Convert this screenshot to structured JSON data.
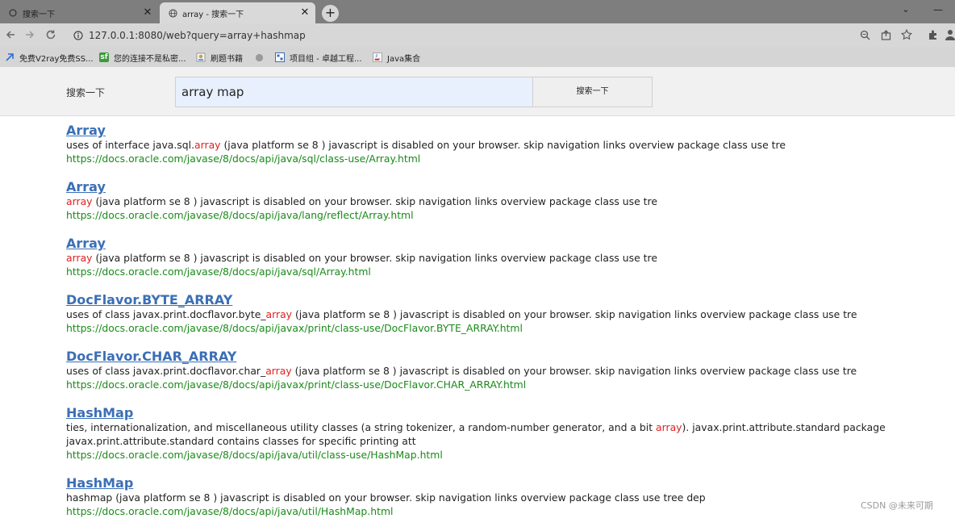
{
  "browser": {
    "tabs": [
      {
        "title": "搜索一下",
        "active": false
      },
      {
        "title": "array - 搜索一下",
        "active": true
      }
    ],
    "address": "127.0.0.1:8080/web?query=array+hashmap",
    "bookmarks": [
      {
        "label": "免费V2ray免费SS...",
        "icon": "bookmark-icon"
      },
      {
        "label": "您的连接不是私密...",
        "icon": "sf-icon"
      },
      {
        "label": "刷题书籍",
        "icon": "book-icon"
      },
      {
        "label": "项目组 - 卓越工程...",
        "icon": "project-icon"
      },
      {
        "label": "Java集合",
        "icon": "java-icon"
      }
    ]
  },
  "page": {
    "brand": "搜索一下",
    "search_value": "array map",
    "search_button": "搜索一下"
  },
  "results": [
    {
      "title": "Array",
      "snippet": [
        [
          {
            "t": "uses of interface java.sql.",
            "h": false
          },
          {
            "t": "array",
            "h": true
          },
          {
            "t": " (java platform se 8 ) javascript is disabled on your browser. skip navigation links overview package class use tre",
            "h": false
          }
        ]
      ],
      "url": "https://docs.oracle.com/javase/8/docs/api/java/sql/class-use/Array.html"
    },
    {
      "title": "Array",
      "snippet": [
        [
          {
            "t": "array",
            "h": true
          },
          {
            "t": " (java platform se 8 ) javascript is disabled on your browser. skip navigation links overview package class use tre",
            "h": false
          }
        ]
      ],
      "url": "https://docs.oracle.com/javase/8/docs/api/java/lang/reflect/Array.html"
    },
    {
      "title": "Array",
      "snippet": [
        [
          {
            "t": "array",
            "h": true
          },
          {
            "t": " (java platform se 8 ) javascript is disabled on your browser. skip navigation links overview package class use tre",
            "h": false
          }
        ]
      ],
      "url": "https://docs.oracle.com/javase/8/docs/api/java/sql/Array.html"
    },
    {
      "title": "DocFlavor.BYTE_ARRAY",
      "snippet": [
        [
          {
            "t": "uses of class javax.print.docflavor.byte_",
            "h": false
          },
          {
            "t": "array",
            "h": true
          },
          {
            "t": " (java platform se 8 ) javascript is disabled on your browser. skip navigation links overview package class use tre",
            "h": false
          }
        ]
      ],
      "url": "https://docs.oracle.com/javase/8/docs/api/javax/print/class-use/DocFlavor.BYTE_ARRAY.html"
    },
    {
      "title": "DocFlavor.CHAR_ARRAY",
      "snippet": [
        [
          {
            "t": "uses of class javax.print.docflavor.char_",
            "h": false
          },
          {
            "t": "array",
            "h": true
          },
          {
            "t": " (java platform se 8 ) javascript is disabled on your browser. skip navigation links overview package class use tre",
            "h": false
          }
        ]
      ],
      "url": "https://docs.oracle.com/javase/8/docs/api/javax/print/class-use/DocFlavor.CHAR_ARRAY.html"
    },
    {
      "title": "HashMap",
      "snippet": [
        [
          {
            "t": "ties, internationalization, and miscellaneous utility classes (a string tokenizer, a random-number generator, and a bit ",
            "h": false
          },
          {
            "t": "array",
            "h": true
          },
          {
            "t": "). javax.print.attribute.standard package",
            "h": false
          }
        ],
        [
          {
            "t": "javax.print.attribute.standard contains classes for specific printing att",
            "h": false
          }
        ]
      ],
      "url": "https://docs.oracle.com/javase/8/docs/api/java/util/class-use/HashMap.html"
    },
    {
      "title": "HashMap",
      "snippet": [
        [
          {
            "t": "hashmap (java platform se 8 ) javascript is disabled on your browser. skip navigation links overview package class use tree dep",
            "h": false
          }
        ]
      ],
      "url": "https://docs.oracle.com/javase/8/docs/api/java/util/HashMap.html"
    }
  ],
  "watermark": "CSDN @未来可期",
  "colors": {
    "link": "#3b6fb6",
    "highlight": "#e02020",
    "url": "#1a8a1a"
  }
}
